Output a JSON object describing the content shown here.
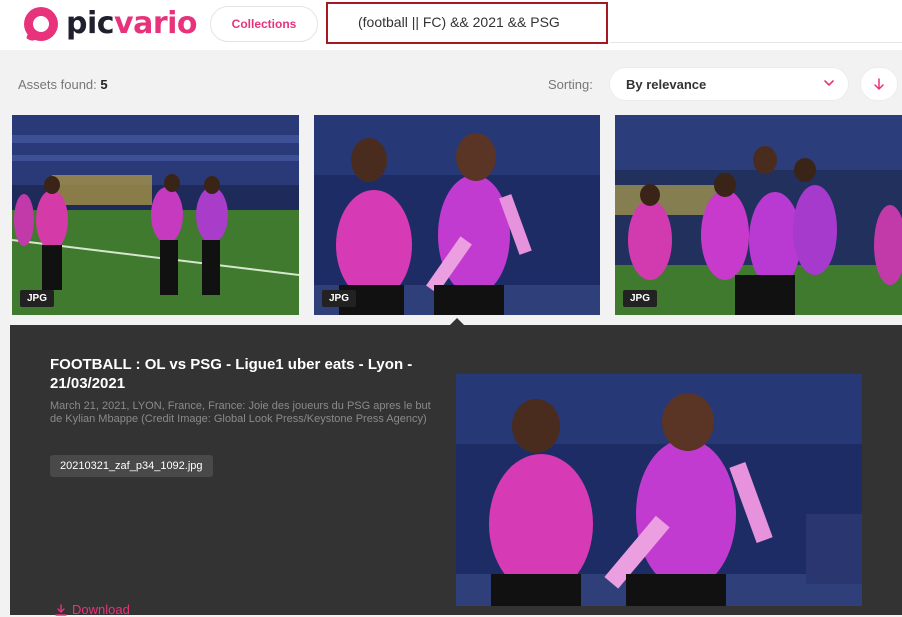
{
  "header": {
    "logo": {
      "text_part1": "pic",
      "text_part2": "vario"
    },
    "collections_label": "Collections",
    "search": {
      "value": "(football || FC) && 2021 && PSG"
    }
  },
  "toolbar": {
    "assets_label": "Assets found:",
    "assets_count": "5",
    "sorting_label": "Sorting:",
    "sort_value": "By relevance"
  },
  "thumbnails": [
    {
      "badge": "JPG"
    },
    {
      "badge": "JPG"
    },
    {
      "badge": "JPG"
    }
  ],
  "detail": {
    "title": "FOOTBALL : OL vs PSG - Ligue1 uber eats - Lyon - 21/03/2021",
    "description": "March 21, 2021, LYON, France, France: Joie des joueurs du PSG apres le but de Kylian Mbappe (Credit Image: Global Look Press/Keystone Press Agency)",
    "filename": "20210321_zaf_p34_1092.jpg",
    "download_label": "Download"
  },
  "colors": {
    "accent": "#e8337c",
    "search_border": "#a3191f",
    "panel_bg": "#333333"
  }
}
